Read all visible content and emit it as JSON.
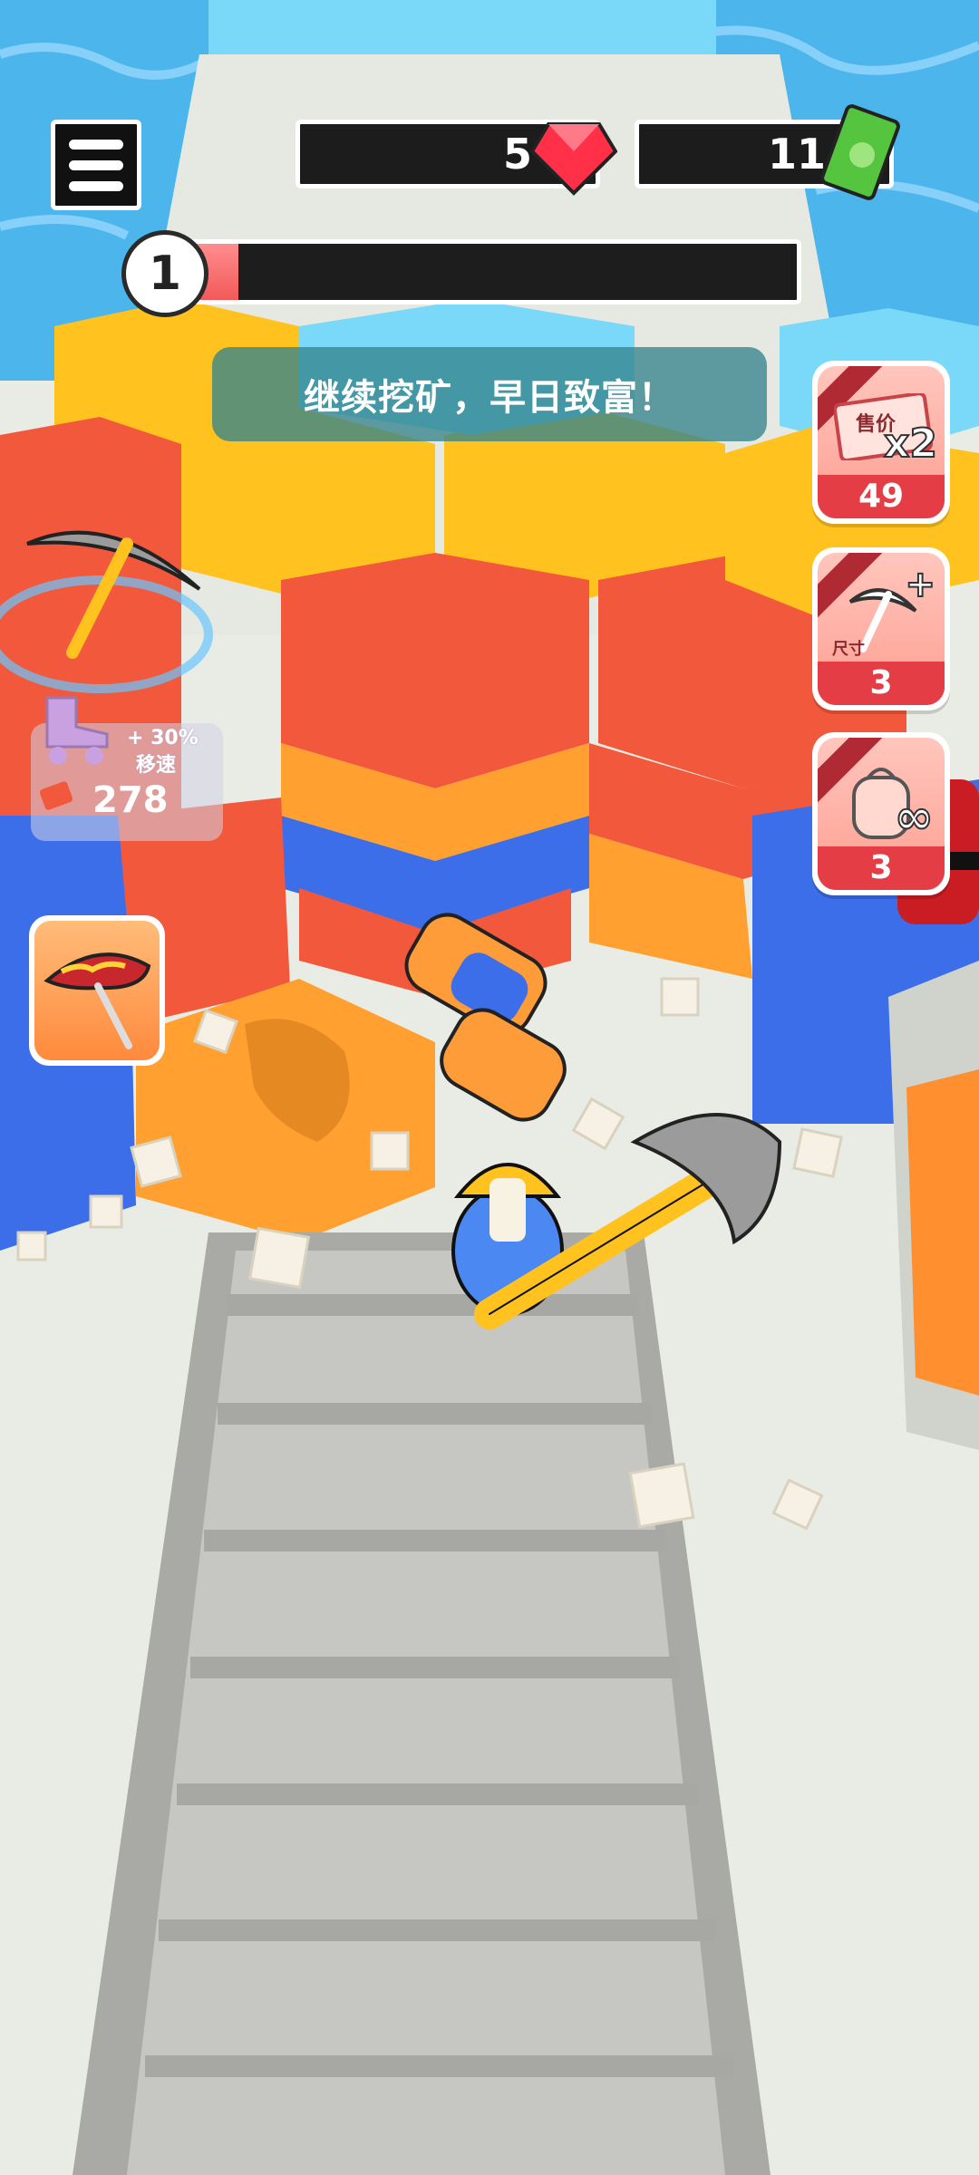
{
  "hud": {
    "gems": "5",
    "cash": "11",
    "level": "1",
    "level_progress": 0.08
  },
  "banner": "继续挖矿，早日致富！",
  "boosts": [
    {
      "name": "sell-price",
      "label": "售价",
      "badge": "x2",
      "count": "49"
    },
    {
      "name": "pickaxe-size",
      "label": "尺寸",
      "badge": "+",
      "count": "3"
    },
    {
      "name": "backpack",
      "badge": "∞",
      "count": "3"
    }
  ],
  "speed_offer": {
    "bonus": "+ 30%",
    "label": "移速",
    "price": "278"
  },
  "colors": {
    "water": "#4cb6ec",
    "hex_red": "#f2583b",
    "hex_yellow": "#ffc21f",
    "hex_blue": "#3b6ee8",
    "hex_orange": "#ffa030",
    "accent_red": "#e53d46"
  }
}
